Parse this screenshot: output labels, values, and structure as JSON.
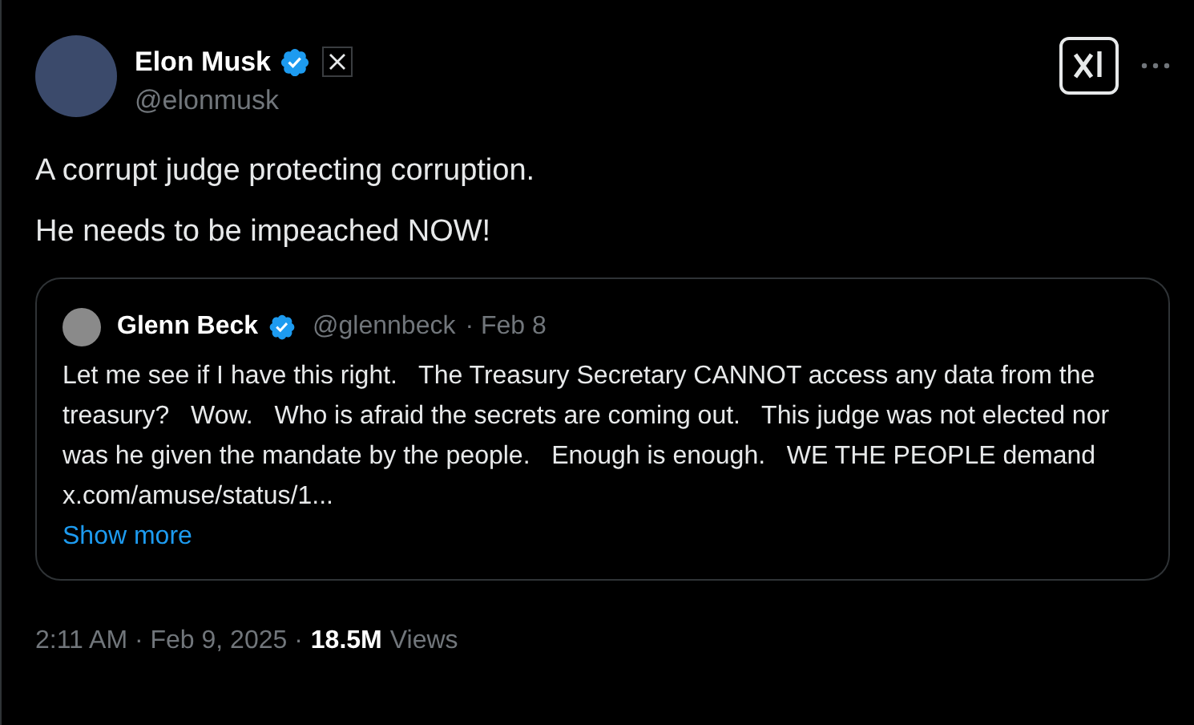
{
  "author": {
    "name": "Elon Musk",
    "handle": "@elonmusk"
  },
  "text": [
    "A corrupt judge protecting corruption.",
    "He needs to be impeached NOW!"
  ],
  "quote": {
    "name": "Glenn Beck",
    "handle": "@glennbeck",
    "date": "· Feb 8",
    "text": "Let me see if I have this right.   The Treasury Secretary CANNOT access any data from the treasury?   Wow.   Who is afraid the secrets are coming out.   This judge was not elected nor was he given the mandate by the people.   Enough is enough.   WE THE PEOPLE demand x.com/amuse/status/1...",
    "show_more": "Show more"
  },
  "footer": {
    "timestamp": "2:11 AM · Feb 9, 2025 ·",
    "views": "18.5M",
    "views_label": "Views"
  }
}
